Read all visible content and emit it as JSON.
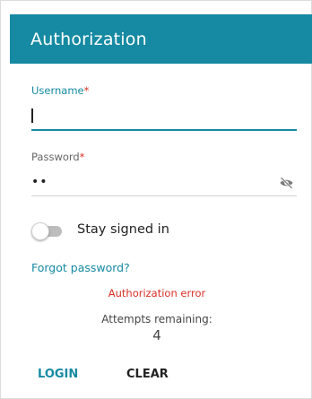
{
  "header": {
    "title": "Authorization"
  },
  "form": {
    "username": {
      "label": "Username",
      "required_mark": "*",
      "value": ""
    },
    "password": {
      "label": "Password",
      "required_mark": "*",
      "value": "••"
    },
    "stay_signed_in": {
      "label": "Stay signed in",
      "checked": false
    },
    "forgot_password": "Forgot password?",
    "error": "Authorization error",
    "attempts": {
      "label": "Attempts remaining:",
      "value": "4"
    }
  },
  "buttons": {
    "login": "LOGIN",
    "clear": "CLEAR"
  },
  "icons": {
    "password_visibility": "eye-off-icon"
  },
  "colors": {
    "accent": "#168aa2",
    "error": "#d93025",
    "text": "#222222"
  }
}
